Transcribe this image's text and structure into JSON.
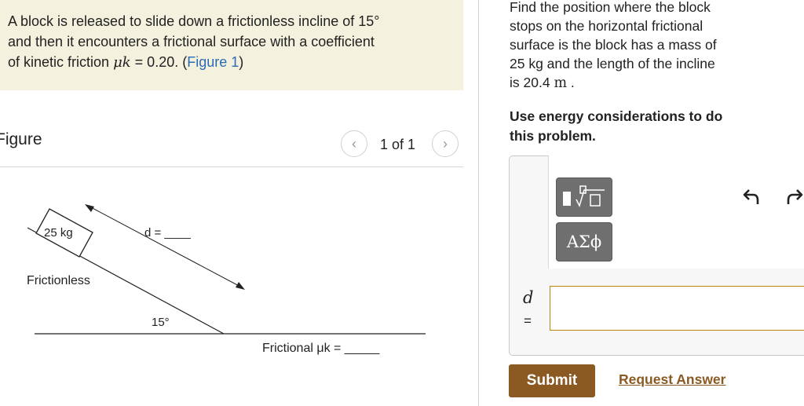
{
  "problem": {
    "line1": "A block is released to slide down a frictionless incline of 15°",
    "line2": "and then it encounters a frictional surface with a coefficient",
    "line3_prefix": "of kinetic friction ",
    "mu_symbol": "μk",
    "line3_value": " = 0.20. (",
    "figure_link": "Figure 1",
    "line3_suffix": ")"
  },
  "figure_panel": {
    "title": "Figure",
    "pager_text": "1 of 1",
    "prev_icon": "chevron-left-icon",
    "next_icon": "chevron-right-icon",
    "prev_glyph": "‹",
    "next_glyph": "›"
  },
  "diagram": {
    "mass_label": "25 kg",
    "distance_label": "d = ____",
    "incline_label": "Frictionless",
    "angle_label": "15°",
    "surface_label": "Frictional μk = _____"
  },
  "question": {
    "line1": "Find the position where the block",
    "line2": "stops on the horizontal frictional",
    "line3": "surface is the block has a mass of",
    "line4": "25 kg and the length of the incline",
    "line5_prefix": "is 20.4 ",
    "line5_unit": "m",
    "line5_suffix": " ."
  },
  "instruction": {
    "line1": "Use energy considerations to do",
    "line2": "this problem."
  },
  "answer": {
    "toolbar_templates_icon": "templates-icon",
    "toolbar_symbols_label": "ΑΣϕ",
    "undo_icon": "undo-icon",
    "redo_icon": "redo-icon",
    "variable": "d",
    "equals": "=",
    "input_value": ""
  },
  "actions": {
    "submit_label": "Submit",
    "request_label": "Request Answer"
  },
  "colors": {
    "problem_bg": "#f4f1de",
    "link_blue": "#2a6bb3",
    "brand_brown": "#8a5a22",
    "input_border": "#b8860b",
    "tool_gray": "#6f6f6f"
  }
}
